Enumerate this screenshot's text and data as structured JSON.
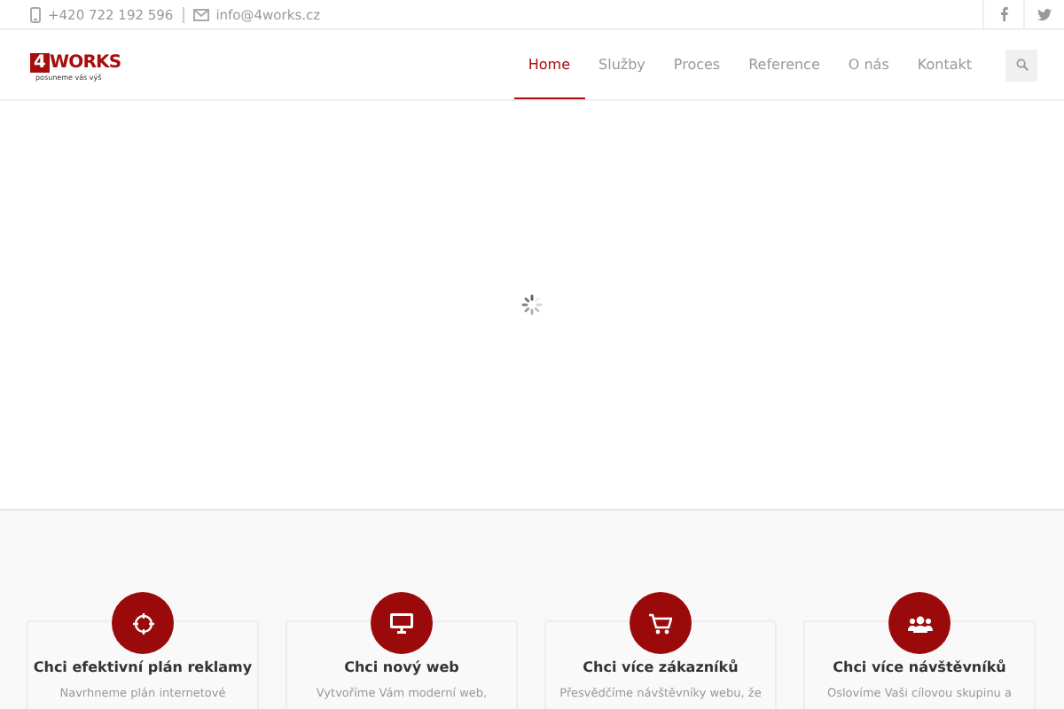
{
  "topbar": {
    "phone": "+420 722 192 596",
    "email": "info@4works.cz"
  },
  "logo": {
    "mark": "4",
    "name": "WORKS",
    "tagline": "posuneme vás výš"
  },
  "nav": [
    {
      "label": "Home",
      "selected": true
    },
    {
      "label": "Služby",
      "selected": false
    },
    {
      "label": "Proces",
      "selected": false
    },
    {
      "label": "Reference",
      "selected": false
    },
    {
      "label": "O nás",
      "selected": false
    },
    {
      "label": "Kontakt",
      "selected": false
    }
  ],
  "services": [
    {
      "title": "Chci efektivní plán reklamy",
      "text": "Navrhneme plán internetové"
    },
    {
      "title": "Chci nový web",
      "text": "Vytvoříme Vám moderní web,"
    },
    {
      "title": "Chci více zákazníků",
      "text": "Přesvědčíme návštěvníky webu, že"
    },
    {
      "title": "Chci více návštěvníků",
      "text": "Oslovíme Vaši cílovou skupinu a"
    }
  ]
}
